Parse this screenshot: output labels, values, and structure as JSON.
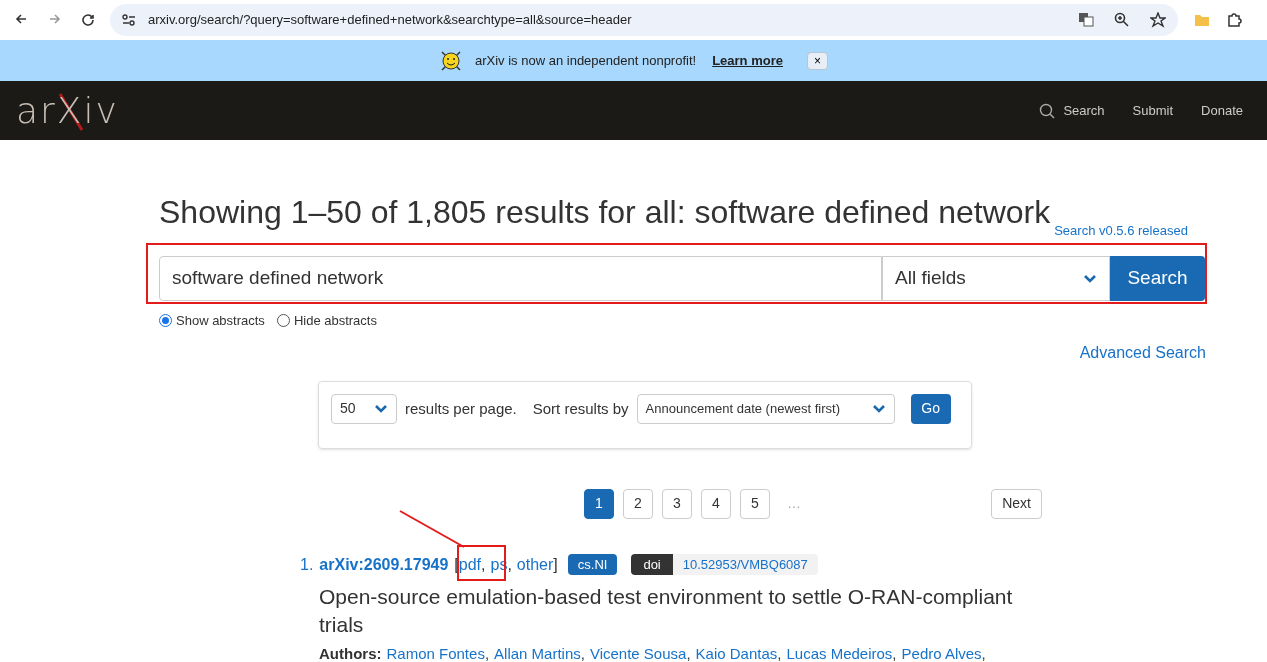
{
  "browser": {
    "url": "arxiv.org/search/?query=software+defined+network&searchtype=all&source=header"
  },
  "banner": {
    "text": "arXiv is now an independent nonprofit!",
    "link": "Learn more",
    "close": "×"
  },
  "header": {
    "logo": "arXiv",
    "nav": [
      {
        "label": "Search",
        "kind": "search"
      },
      {
        "label": "Submit",
        "kind": "link"
      },
      {
        "label": "Donate",
        "kind": "link"
      }
    ]
  },
  "title": "Showing 1–50 of 1,805 results for all: software defined network",
  "release_note": "Search v0.5.6 released",
  "search": {
    "value": "software defined network",
    "field": "All fields",
    "button": "Search"
  },
  "abstract_options": [
    {
      "label": "Show abstracts",
      "selected": true
    },
    {
      "label": "Hide abstracts",
      "selected": false
    }
  ],
  "advanced_search": "Advanced Search",
  "options": {
    "per_page": "50",
    "per_page_label": "results per page.",
    "sort_label": "Sort results by",
    "sort": "Announcement date (newest first)",
    "go": "Go"
  },
  "pagination": {
    "pages": [
      {
        "label": "1",
        "selected": true
      },
      {
        "label": "2",
        "selected": false
      },
      {
        "label": "3",
        "selected": false
      },
      {
        "label": "4",
        "selected": false
      },
      {
        "label": "5",
        "selected": false
      }
    ],
    "ellipsis": "…",
    "next": "Next"
  },
  "results": [
    {
      "number": "1.",
      "id": "arXiv:2609.17949",
      "formats_open": "[",
      "formats": [
        "pdf",
        "ps",
        "other"
      ],
      "separator": ",",
      "formats_close": "]",
      "category": "cs.NI",
      "doi_label": "doi",
      "doi": "10.52953/VMBQ6087",
      "title": "Open-source emulation-based test environment to settle O-RAN-compliant trials",
      "authors_label": "Authors:",
      "authors": [
        "Ramon Fontes",
        "Allan Martins",
        "Vicente Sousa",
        "Kaio Dantas",
        "Lucas Medeiros",
        "Pedro Alves"
      ]
    }
  ]
}
